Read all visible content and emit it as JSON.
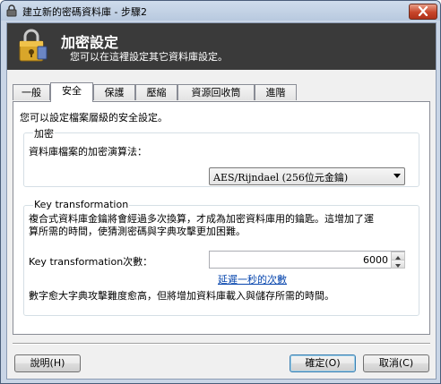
{
  "window": {
    "title": "建立新的密碼資料庫 - 步驟2",
    "close_label": "X"
  },
  "banner": {
    "title": "加密設定",
    "subtitle": "您可以在這裡設定其它資料庫設定。"
  },
  "tabs": [
    {
      "label": "一般",
      "active": false
    },
    {
      "label": "安全",
      "active": true
    },
    {
      "label": "保護",
      "active": false
    },
    {
      "label": "壓縮",
      "active": false
    },
    {
      "label": "資源回收筒",
      "active": false
    },
    {
      "label": "進階",
      "active": false
    }
  ],
  "security": {
    "description": "您可以設定檔案層級的安全設定。",
    "encryption": {
      "group_label": "加密",
      "algorithm_label": "資料庫檔案的加密演算法：",
      "algorithm_value": "AES/Rijndael (256位元金鑰)"
    },
    "key_transformation": {
      "group_label": "Key transformation",
      "description_line1": "複合式資料庫金鑰將會經過多次換算，才成為加密資料庫用的鑰匙。這增加了運",
      "description_line2": "算所需的時間，使猜測密碼與字典攻擊更加困難。",
      "rounds_label": "Key transformation次數：",
      "rounds_value": "6000",
      "delay_link": "延遲一秒的次數",
      "note": "數字愈大字典攻擊難度愈高，但將增加資料庫載入與儲存所需的時間。"
    }
  },
  "buttons": {
    "help": "說明(H)",
    "ok": "確定(O)",
    "cancel": "取消(C)"
  },
  "colors": {
    "banner_bg": "#3a3a3a",
    "link": "#0645ad",
    "close_button": "#c7452a"
  }
}
